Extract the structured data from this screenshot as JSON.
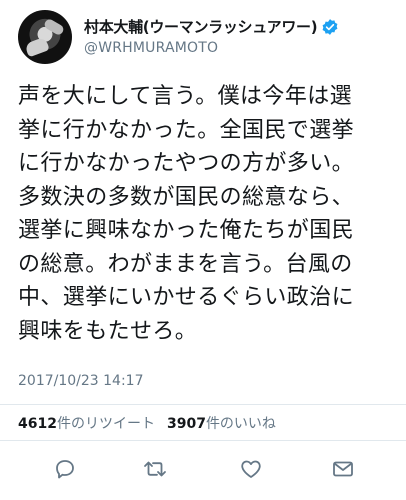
{
  "tweet": {
    "display_name": "村本大輔(ウーマンラッシュアワー)",
    "handle": "@WRHMURAMOTO",
    "text_lines": [
      "声を大にして言う。僕は今年は選",
      "挙に行かなかった。全国民で選挙",
      "に行かなかったやつの方が多い。",
      "多数決の多数が国民の総意なら、",
      "選挙に興味なかった俺たちが国民",
      "の総意。わがままを言う。台風の",
      "中、選挙にいかせるぐらい政治に",
      "興味をもたせろ。"
    ],
    "timestamp": "2017/10/23 14:17",
    "retweets_count": "4612",
    "retweets_label": "件のリツイート",
    "likes_count": "3907",
    "likes_label": "件のいいね"
  },
  "icons": {
    "verified": "verified-badge-icon",
    "reply": "reply-icon",
    "retweet": "retweet-icon",
    "like": "heart-icon",
    "dm": "envelope-icon"
  },
  "colors": {
    "verified": "#1da1f2",
    "secondary_text": "#657786",
    "icon_gray": "#657786"
  }
}
